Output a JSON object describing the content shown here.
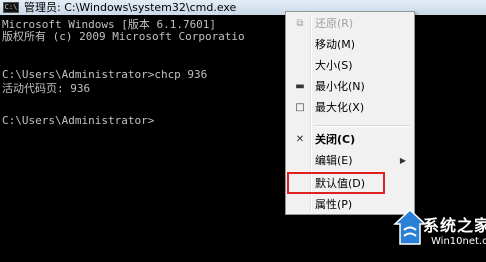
{
  "window": {
    "title": "管理员: C:\\Windows\\system32\\cmd.exe",
    "icon_label": "C:\\"
  },
  "console": {
    "lines": [
      "Microsoft Windows [版本 6.1.7601]",
      "版权所有 (c) 2009 Microsoft Corporatio",
      "",
      "C:\\Users\\Administrator>chcp 936",
      "活动代码页: 936",
      "",
      "C:\\Users\\Administrator>"
    ]
  },
  "menu": {
    "items": [
      {
        "label": "还原(R)",
        "icon": "restore-icon",
        "glyph": "⧉",
        "disabled": true
      },
      {
        "label": "移动(M)",
        "icon": "",
        "glyph": "",
        "disabled": false
      },
      {
        "label": "大小(S)",
        "icon": "",
        "glyph": "",
        "disabled": false
      },
      {
        "label": "最小化(N)",
        "icon": "minimize-icon",
        "glyph": "▬",
        "disabled": false
      },
      {
        "label": "最大化(X)",
        "icon": "maximize-icon",
        "glyph": "□",
        "disabled": false
      },
      {
        "label": "关闭(C)",
        "icon": "close-icon",
        "glyph": "✕",
        "disabled": false,
        "bold": true
      },
      {
        "label": "编辑(E)",
        "icon": "",
        "glyph": "",
        "disabled": false,
        "submenu": true
      },
      {
        "label": "默认值(D)",
        "icon": "",
        "glyph": "",
        "disabled": false,
        "highlighted": true
      },
      {
        "label": "属性(P)",
        "icon": "",
        "glyph": "",
        "disabled": false
      }
    ],
    "highlight_color": "#e02020"
  },
  "watermark": {
    "name": "系统之家",
    "url": "Win10net.com"
  }
}
